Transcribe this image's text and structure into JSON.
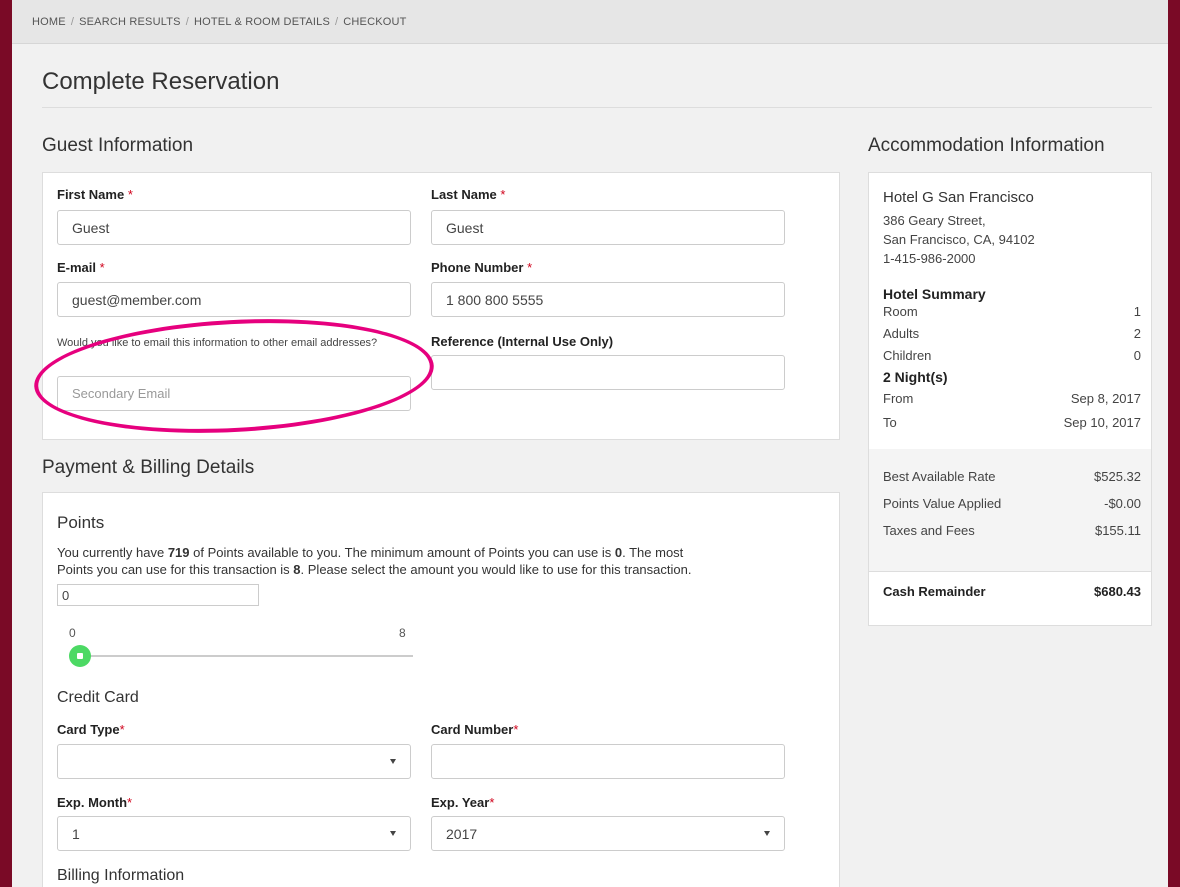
{
  "breadcrumb": [
    "HOME",
    "SEARCH RESULTS",
    "HOTEL & ROOM DETAILS",
    "CHECKOUT"
  ],
  "page_title": "Complete Reservation",
  "guest": {
    "heading": "Guest Information",
    "first_name_label": "First Name",
    "first_name_value": "Guest",
    "last_name_label": "Last Name",
    "last_name_value": "Guest",
    "email_label": "E-mail",
    "email_value": "guest@member.com",
    "phone_label": "Phone Number",
    "phone_value": "1 800 800 5555",
    "secondary_note": "Would you like to email this information to other email addresses?",
    "secondary_placeholder": "Secondary Email",
    "reference_label": "Reference (Internal Use Only)",
    "reference_value": "",
    "required_mark": "*"
  },
  "payment": {
    "heading": "Payment & Billing Details",
    "points_heading": "Points",
    "points_text_1": "You currently have ",
    "points_available": "719",
    "points_text_2": " of Points available to you. The minimum amount of Points you can use is ",
    "points_min": "0",
    "points_text_3": ". The most",
    "points_text_4": "Points you can use for this transaction is ",
    "points_max": "8",
    "points_text_5": ". Please select the amount you would like to use for this transaction.",
    "points_input_value": "0",
    "slider_min_label": "0",
    "slider_max_label": "8",
    "slider_value_fraction": 0,
    "credit_card_heading": "Credit Card",
    "card_type_label": "Card Type",
    "card_type_value": "",
    "card_number_label": "Card Number",
    "card_number_value": "",
    "exp_month_label": "Exp. Month",
    "exp_month_value": "1",
    "exp_year_label": "Exp. Year",
    "exp_year_value": "2017",
    "billing_heading": "Billing Information"
  },
  "accommodation": {
    "heading": "Accommodation Information",
    "hotel_name": "Hotel G San Francisco",
    "address_line1": "386 Geary Street,",
    "address_line2": "San Francisco, CA, 94102",
    "phone": "1-415-986-2000",
    "summary_heading": "Hotel Summary",
    "room_label": "Room",
    "room_value": "1",
    "adults_label": "Adults",
    "adults_value": "2",
    "children_label": "Children",
    "children_value": "0",
    "nights": "2 Night(s)",
    "from_label": "From",
    "from_value": "Sep 8, 2017",
    "to_label": "To",
    "to_value": "Sep 10, 2017",
    "best_rate_label": "Best Available Rate",
    "best_rate_value": "$525.32",
    "points_applied_label": "Points Value Applied",
    "points_applied_value": "-$0.00",
    "taxes_label": "Taxes and Fees",
    "taxes_value": "$155.11",
    "cash_label": "Cash Remainder",
    "cash_value": "$680.43"
  },
  "colors": {
    "frame": "#7a0a26",
    "highlight": "#e6007e",
    "slider": "#4cd964",
    "required": "#d0021b"
  }
}
